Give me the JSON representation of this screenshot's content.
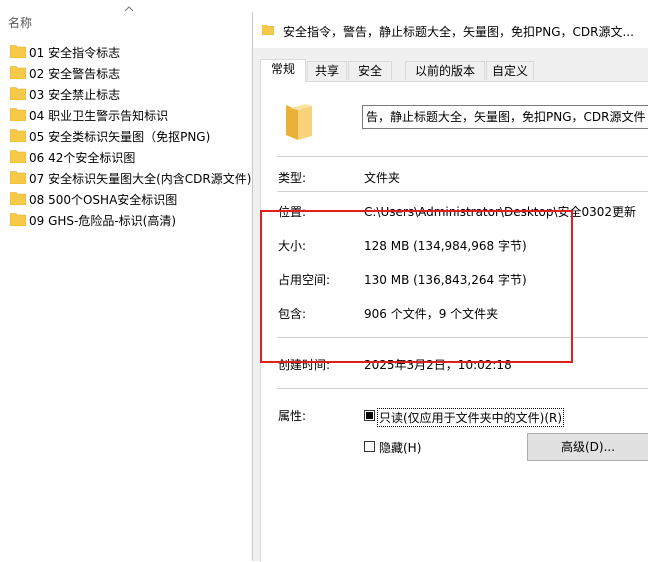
{
  "explorer": {
    "column_name": "名称",
    "items": [
      {
        "label": "01 安全指令标志"
      },
      {
        "label": "02 安全警告标志"
      },
      {
        "label": "03 安全禁止标志"
      },
      {
        "label": "04 职业卫生警示告知标识"
      },
      {
        "label": "05 安全类标识矢量图（免抠PNG)"
      },
      {
        "label": "06 42个安全标识图"
      },
      {
        "label": "07 安全标识矢量图大全(内含CDR源文件)"
      },
      {
        "label": "08 500个OSHA安全标识图"
      },
      {
        "label": "09 GHS-危险品-标识(高清)"
      }
    ]
  },
  "dialog": {
    "title": "安全指令，警告，静止标题大全，矢量图，免扣PNG，CDR源文...",
    "tabs": [
      "常规",
      "共享",
      "安全",
      "以前的版本",
      "自定义"
    ],
    "active_tab": "常规",
    "name_value": "告，静止标题大全，矢量图，免扣PNG，CDR源文件",
    "props": {
      "type_label": "类型:",
      "type_value": "文件夹",
      "location_label": "位置:",
      "location_value": "C:\\Users\\Administrator\\Desktop\\安全0302更新",
      "size_label": "大小:",
      "size_value": "128 MB (134,984,968 字节)",
      "disk_label": "占用空间:",
      "disk_value": "130 MB (136,843,264 字节)",
      "contains_label": "包含:",
      "contains_value": "906 个文件，9 个文件夹",
      "created_label": "创建时间:",
      "created_value": "2025年3月2日，10:02:18"
    },
    "attributes": {
      "label": "属性:",
      "readonly_label": "只读(仅应用于文件夹中的文件)(R)",
      "readonly_state": "indeterminate",
      "hidden_label": "隐藏(H)",
      "hidden_checked": false,
      "advanced_button": "高级(D)..."
    }
  },
  "colors": {
    "folder_yellow": "#f7c948",
    "highlight_red": "#e0201c",
    "dialog_bg": "#f0f0f0"
  }
}
